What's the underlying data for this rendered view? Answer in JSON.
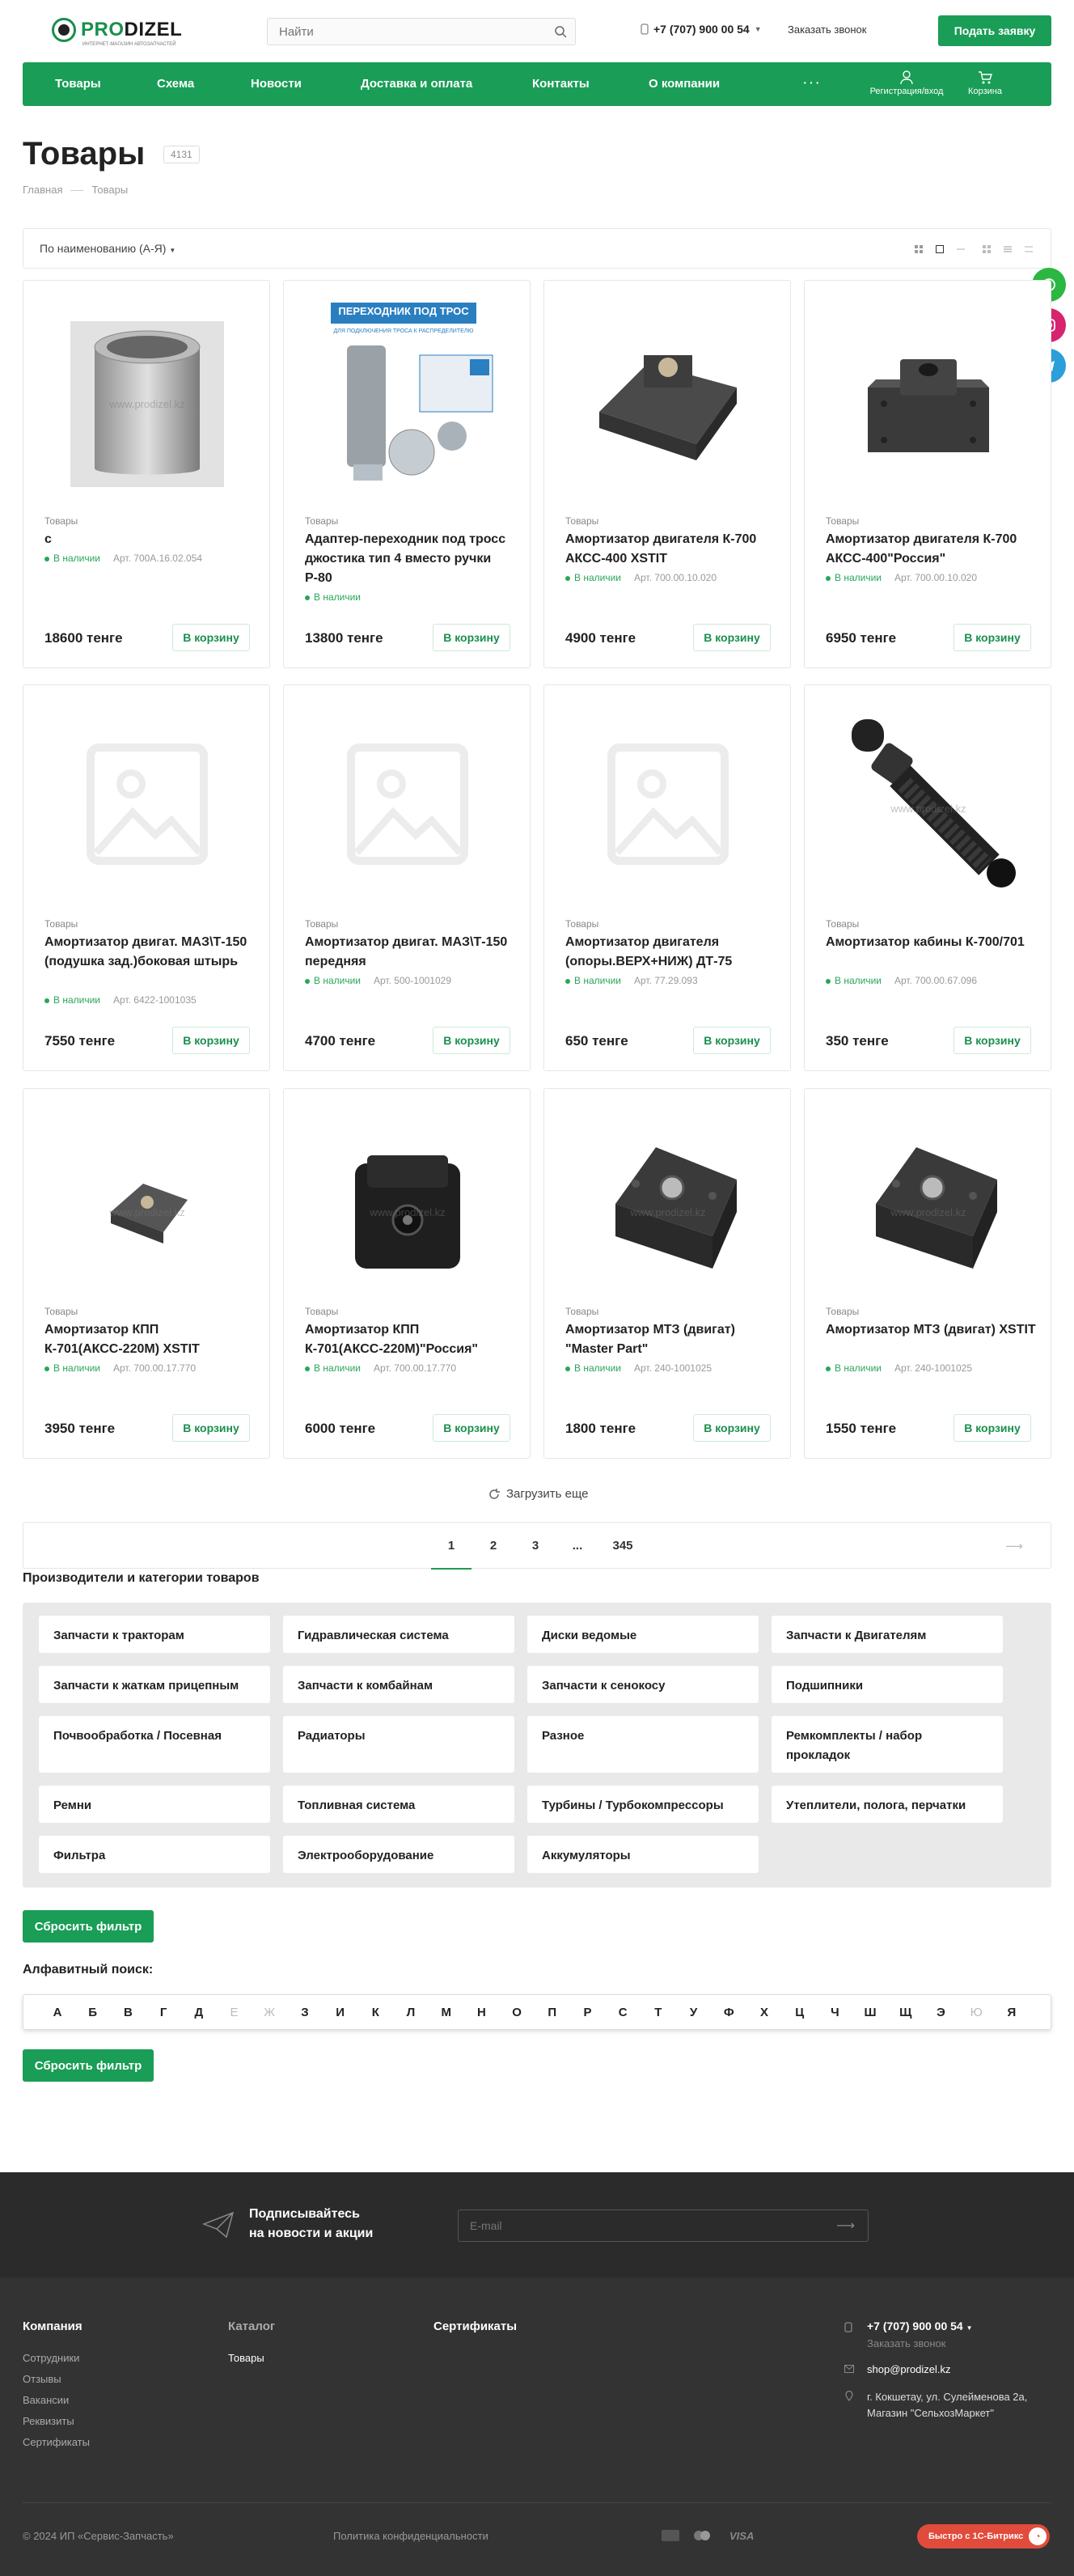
{
  "header": {
    "logo_text_1": "PRO",
    "logo_text_2": "DIZEL",
    "logo_sub": "ИНТЕРНЕТ-МАГАЗИН АВТОЗАПЧАСТЕЙ",
    "search_placeholder": "Найти",
    "phone": "+7 (707) 900 00 54",
    "callback": "Заказать звонок",
    "request_button": "Подать заявку"
  },
  "nav": {
    "items": [
      "Товары",
      "Схема",
      "Новости",
      "Доставка и оплата",
      "Контакты",
      "О компании"
    ],
    "more": "···",
    "account": "Регистрация/вход",
    "cart": "Корзина"
  },
  "page": {
    "title": "Товары",
    "count": "4131",
    "breadcrumbs": [
      "Главная",
      "Товары"
    ],
    "sort_label": "По наименованию (А-Я)"
  },
  "products": [
    {
      "cat": "Товары",
      "name": "с",
      "sku": "Арт. 700A.16.02.054",
      "stock": "В наличии",
      "price": "18600 тенге",
      "image": "bushing"
    },
    {
      "cat": "Товары",
      "name": "Адаптер-переходник под тросс джостика тип 4 вместо ручки Р-80",
      "sku": "",
      "stock": "В наличии",
      "price": "13800 тенге",
      "image": "adapter"
    },
    {
      "cat": "Товары",
      "name": "Амортизатор двигателя К-700 АКСС-400 XSTIT",
      "sku": "Арт. 700.00.10.020",
      "stock": "В наличии",
      "price": "4900 тенге",
      "image": "mount"
    },
    {
      "cat": "Товары",
      "name": "Амортизатор двигателя К-700 АКСС-400\"Россия\"",
      "sku": "Арт. 700.00.10.020",
      "stock": "В наличии",
      "price": "6950 тенге",
      "image": "mount2"
    },
    {
      "cat": "Товары",
      "name": "Амортизатор двигат. МАЗ\\Т-150 (подушка зад.)боковая штырь",
      "sku": "Арт. 6422-1001035",
      "stock": "В наличии",
      "price": "7550 тенге",
      "image": "placeholder"
    },
    {
      "cat": "Товары",
      "name": "Амортизатор двигат. МАЗ\\Т-150 передняя",
      "sku": "Арт. 500-1001029",
      "stock": "В наличии",
      "price": "4700 тенге",
      "image": "placeholder"
    },
    {
      "cat": "Товары",
      "name": "Амортизатор двигателя (опоры.ВЕРХ+НИЖ) ДТ-75",
      "sku": "Арт. 77.29.093",
      "stock": "В наличии",
      "price": "650 тенге",
      "image": "placeholder"
    },
    {
      "cat": "Товары",
      "name": "Амортизатор кабины К-700/701",
      "sku": "Арт. 700.00.67.096",
      "stock": "В наличии",
      "price": "350 тенге",
      "image": "shock"
    },
    {
      "cat": "Товары",
      "name": "Амортизатор КПП К-701(АКСС-220М) XSTIT",
      "sku": "Арт. 700.00.17.770",
      "stock": "В наличии",
      "price": "3950 тенге",
      "image": "small"
    },
    {
      "cat": "Товары",
      "name": "Амортизатор КПП К-701(АКСС-220М)\"Россия\"",
      "sku": "Арт. 700.00.17.770",
      "stock": "В наличии",
      "price": "6000 тенге",
      "image": "black"
    },
    {
      "cat": "Товары",
      "name": "Амортизатор МТЗ (двигат) \"Master Part\"",
      "sku": "Арт. 240-1001025",
      "stock": "В наличии",
      "price": "1800 тенге",
      "image": "mtz"
    },
    {
      "cat": "Товары",
      "name": "Амортизатор МТЗ (двигат) XSTIT",
      "sku": "Арт. 240-1001025",
      "stock": "В наличии",
      "price": "1550 тенге",
      "image": "mtz"
    }
  ],
  "buy_label": "В корзину",
  "adapter_banner": "ПЕРЕХОДНИК ПОД ТРОС",
  "adapter_banner_sub": "ДЛЯ ПОДКЛЮЧЕНИЯ ТРОСА К РАСПРЕДЕЛИТЕЛЮ",
  "watermark": "www.prodizel.kz",
  "load_more": "Загрузить еще",
  "pagination": [
    "1",
    "2",
    "3",
    "...",
    "345"
  ],
  "pagination_next": "⟶",
  "categories_title": "Производители и категории товаров",
  "categories": [
    "Запчасти к тракторам",
    "Гидравлическая система",
    "Диски ведомые",
    "Запчасти к Двигателям",
    "Запчасти к жаткам прицепным",
    "Запчасти к комбайнам",
    "Запчасти к сенокосу",
    "Подшипники",
    "Почвообработка / Посевная",
    "Радиаторы",
    "Разное",
    "Ремкомплекты / набор прокладок",
    "Ремни",
    "Топливная система",
    "Турбины / Турбокомпрессоры",
    "Утеплители, полога, перчатки",
    "Фильтра",
    "Электрооборудование",
    "Аккумуляторы"
  ],
  "reset_filter": "Сбросить фильтр",
  "alpha_title": "Алфавитный поиск:",
  "alphabet": [
    {
      "l": "А",
      "on": true
    },
    {
      "l": "Б",
      "on": true
    },
    {
      "l": "В",
      "on": true
    },
    {
      "l": "Г",
      "on": true
    },
    {
      "l": "Д",
      "on": true
    },
    {
      "l": "Е",
      "on": false
    },
    {
      "l": "Ж",
      "on": false
    },
    {
      "l": "З",
      "on": true
    },
    {
      "l": "И",
      "on": true
    },
    {
      "l": "К",
      "on": true
    },
    {
      "l": "Л",
      "on": true
    },
    {
      "l": "М",
      "on": true
    },
    {
      "l": "Н",
      "on": true
    },
    {
      "l": "О",
      "on": true
    },
    {
      "l": "П",
      "on": true
    },
    {
      "l": "Р",
      "on": true
    },
    {
      "l": "С",
      "on": true
    },
    {
      "l": "Т",
      "on": true
    },
    {
      "l": "У",
      "on": true
    },
    {
      "l": "Ф",
      "on": true
    },
    {
      "l": "Х",
      "on": true
    },
    {
      "l": "Ц",
      "on": true
    },
    {
      "l": "Ч",
      "on": true
    },
    {
      "l": "Ш",
      "on": true
    },
    {
      "l": "Щ",
      "on": true
    },
    {
      "l": "Э",
      "on": true
    },
    {
      "l": "Ю",
      "on": false
    },
    {
      "l": "Я",
      "on": true
    }
  ],
  "subscribe": {
    "line1": "Подписывайтесь",
    "line2": "на новости и акции",
    "email_placeholder": "E-mail"
  },
  "footer": {
    "company_title": "Компания",
    "company_links": [
      "Сотрудники",
      "Отзывы",
      "Вакансии",
      "Реквизиты",
      "Сертификаты"
    ],
    "catalog_title": "Каталог",
    "catalog_links": [
      "Товары"
    ],
    "certs_title": "Сертификаты",
    "phone": "+7 (707) 900 00 54",
    "callback": "Заказать звонок",
    "email": "shop@prodizel.kz",
    "address_1": "г. Кокшетау, ул. Сулейменова 2а,",
    "address_2": "Магазин \"СельхозМаркет\"",
    "copyright": "© 2024 ИП «Сервис-Запчасть»",
    "privacy": "Политика конфиденциальности",
    "visa": "VISA",
    "bitrix": "Быстро с 1С-Битрикс"
  },
  "colors": {
    "brand": "#1a9d56",
    "dark": "#333333",
    "whatsapp": "#2bb742",
    "instagram": "#d6246e",
    "telegram": "#2b9fd9"
  }
}
